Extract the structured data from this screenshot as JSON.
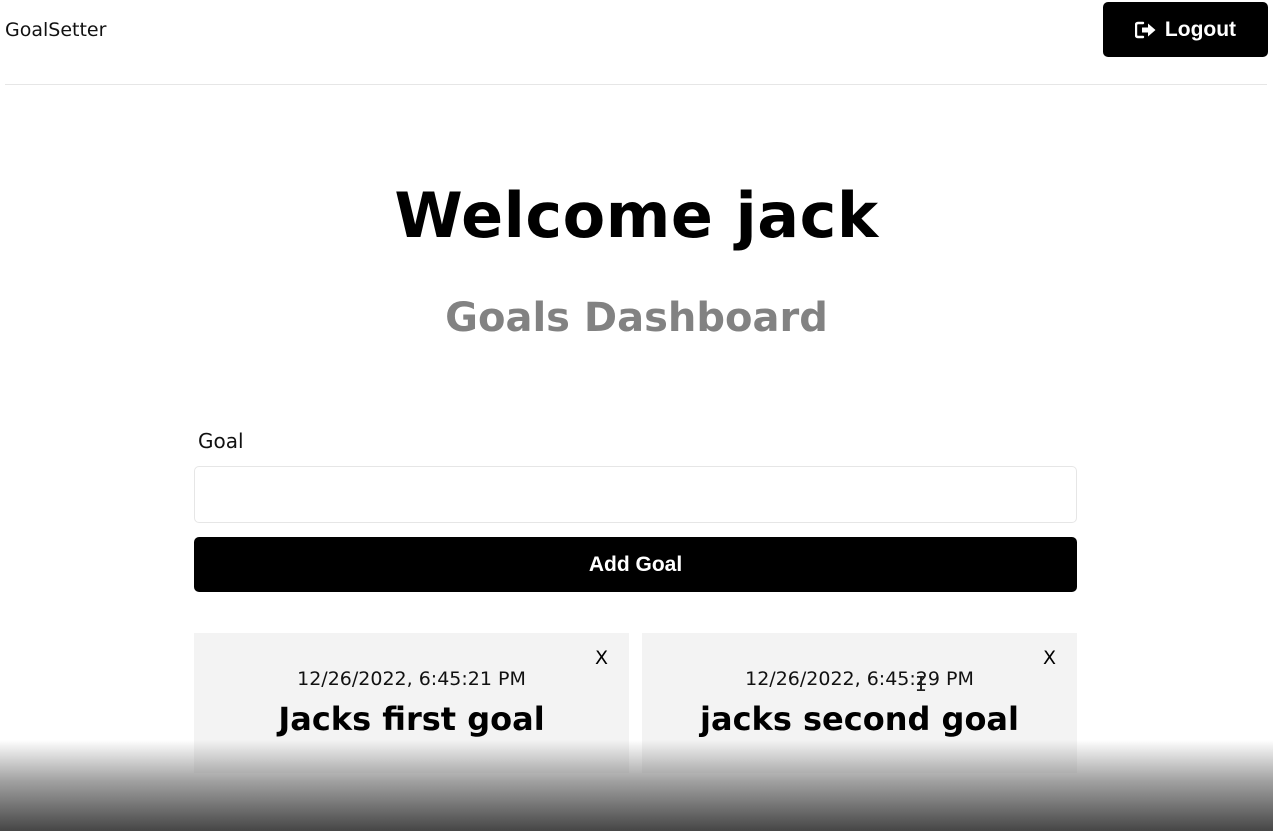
{
  "header": {
    "logo": "GoalSetter",
    "logout_label": "Logout",
    "logout_icon": "sign-out-icon"
  },
  "hero": {
    "welcome": "Welcome jack",
    "subtitle": "Goals Dashboard"
  },
  "form": {
    "label": "Goal",
    "value": "",
    "placeholder": "",
    "submit_label": "Add Goal"
  },
  "goals": [
    {
      "date": "12/26/2022, 6:45:21 PM",
      "text": "Jacks first goal",
      "delete_label": "X"
    },
    {
      "date": "12/26/2022, 6:45:29 PM",
      "text": "jacks second goal",
      "delete_label": "X"
    }
  ],
  "colors": {
    "primary": "#000000",
    "subtitle": "#828282",
    "card_bg": "#f3f3f3",
    "border": "#e6e6e6"
  }
}
